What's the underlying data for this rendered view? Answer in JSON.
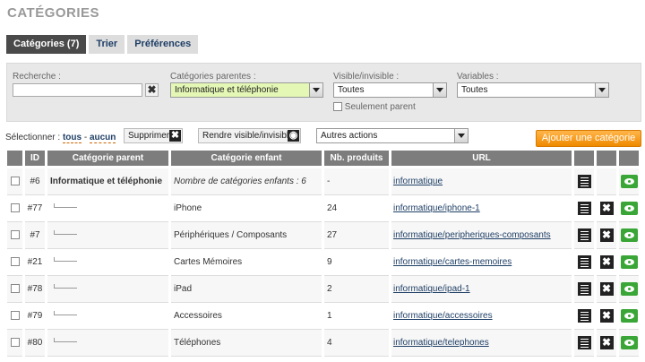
{
  "title": "CATÉGORIES",
  "tabs": [
    {
      "label": "Catégories (7)"
    },
    {
      "label": "Trier"
    },
    {
      "label": "Préférences"
    }
  ],
  "filters": {
    "search_label": "Recherche :",
    "search_value": "",
    "parent_label": "Catégories parentes :",
    "parent_value": "Informatique et téléphonie",
    "visible_label": "Visible/invisible :",
    "visible_value": "Toutes",
    "variables_label": "Variables :",
    "variables_value": "Toutes",
    "only_parent_label": "Seulement parent"
  },
  "actions": {
    "select_label": "Sélectionner :",
    "all": "tous",
    "sep": "-",
    "none": "aucun",
    "delete_label": "Supprimer",
    "toggle_label": "Rendre visible/invisible",
    "other_actions": "Autres actions",
    "add_label": "Ajouter une catégorie"
  },
  "table": {
    "headers": [
      "ID",
      "Catégorie parent",
      "Catégorie enfant",
      "Nb. produits",
      "URL"
    ],
    "rows": [
      {
        "id": "#6",
        "parent": "Informatique et téléphonie",
        "child": "Nombre de catégories enfants : 6",
        "count": "-",
        "url": "informatique"
      },
      {
        "id": "#77",
        "parent": "",
        "child": "iPhone",
        "count": "24",
        "url": "informatique/iphone-1"
      },
      {
        "id": "#7",
        "parent": "",
        "child": "Périphériques / Composants",
        "count": "27",
        "url": "informatique/peripheriques-composants"
      },
      {
        "id": "#21",
        "parent": "",
        "child": "Cartes Mémoires",
        "count": "9",
        "url": "informatique/cartes-memoires"
      },
      {
        "id": "#78",
        "parent": "",
        "child": "iPad",
        "count": "2",
        "url": "informatique/ipad-1"
      },
      {
        "id": "#79",
        "parent": "",
        "child": "Accessoires",
        "count": "1",
        "url": "informatique/accessoires"
      },
      {
        "id": "#80",
        "parent": "",
        "child": "Téléphones",
        "count": "4",
        "url": "informatique/telephones"
      }
    ]
  }
}
